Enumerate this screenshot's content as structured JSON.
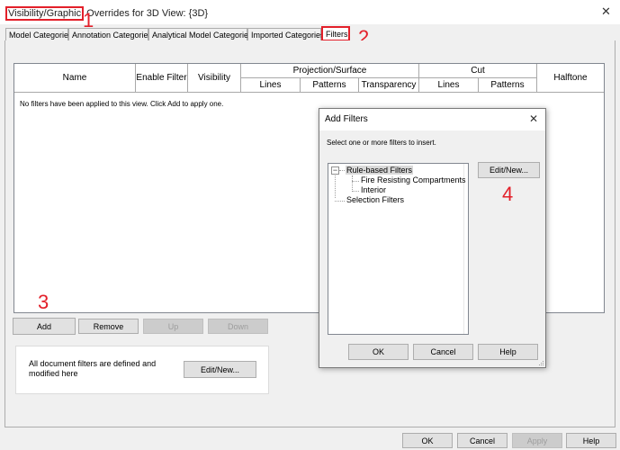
{
  "window": {
    "title_highlight": "Visibility/Graphic",
    "title_rest": "Overrides for 3D View: {3D}",
    "close_glyph": "✕"
  },
  "tabs": [
    "Model Categories",
    "Annotation Categories",
    "Analytical Model Categories",
    "Imported Categories",
    "Filters"
  ],
  "filters_table": {
    "headers": {
      "name": "Name",
      "enable_filter": "Enable Filter",
      "visibility": "Visibility",
      "projection_surface": "Projection/Surface",
      "proj_lines": "Lines",
      "proj_patterns": "Patterns",
      "proj_transparency": "Transparency",
      "cut": "Cut",
      "cut_lines": "Lines",
      "cut_patterns": "Patterns",
      "halftone": "Halftone"
    },
    "empty_message": "No filters have been applied to this view. Click Add to apply one."
  },
  "list_buttons": {
    "add": "Add",
    "remove": "Remove",
    "up": "Up",
    "down": "Down"
  },
  "document_filters": {
    "text": "All document filters are defined and modified here",
    "edit_new": "Edit/New..."
  },
  "footer_buttons": {
    "ok": "OK",
    "cancel": "Cancel",
    "apply": "Apply",
    "help": "Help"
  },
  "add_filters_dialog": {
    "title": "Add Filters",
    "close_glyph": "✕",
    "instruction": "Select one or more filters to insert.",
    "tree": {
      "rule_based": "Rule-based Filters",
      "expander": "−",
      "children": [
        "Fire Resisting Compartments",
        "Interior"
      ],
      "selection": "Selection Filters"
    },
    "edit_new": "Edit/New...",
    "ok": "OK",
    "cancel": "Cancel",
    "help": "Help"
  },
  "callouts": {
    "one": "1",
    "two": "2",
    "three": "3",
    "four": "4"
  },
  "colors": {
    "highlight": "#e3202a",
    "window_bg": "#f0f0f0",
    "button_bg": "#e1e1e1"
  }
}
